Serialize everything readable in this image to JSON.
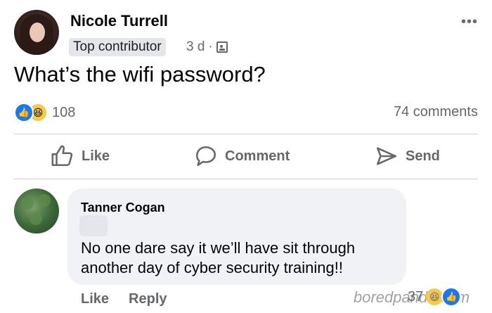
{
  "post": {
    "author": "Nicole Turrell",
    "badge": "Top contributor",
    "time": "3 d",
    "separator": "·",
    "audience_icon": "group-icon",
    "more_icon": "•••",
    "text": "What’s the wifi password?",
    "reaction_count": "108",
    "comments_count": "74 comments"
  },
  "actions": {
    "like": "Like",
    "comment": "Comment",
    "send": "Send"
  },
  "comment": {
    "author": "Tanner Cogan",
    "text": "No one dare say it we’ll have sit through another day of cyber security training!!",
    "like": "Like",
    "reply": "Reply",
    "reaction_count": "37"
  },
  "watermark": "boredpanda.com",
  "colors": {
    "like_blue": "#1877f2",
    "haha_yellow": "#f7c94b",
    "muted_text": "#65676b",
    "bubble_bg": "#f0f2f5"
  }
}
